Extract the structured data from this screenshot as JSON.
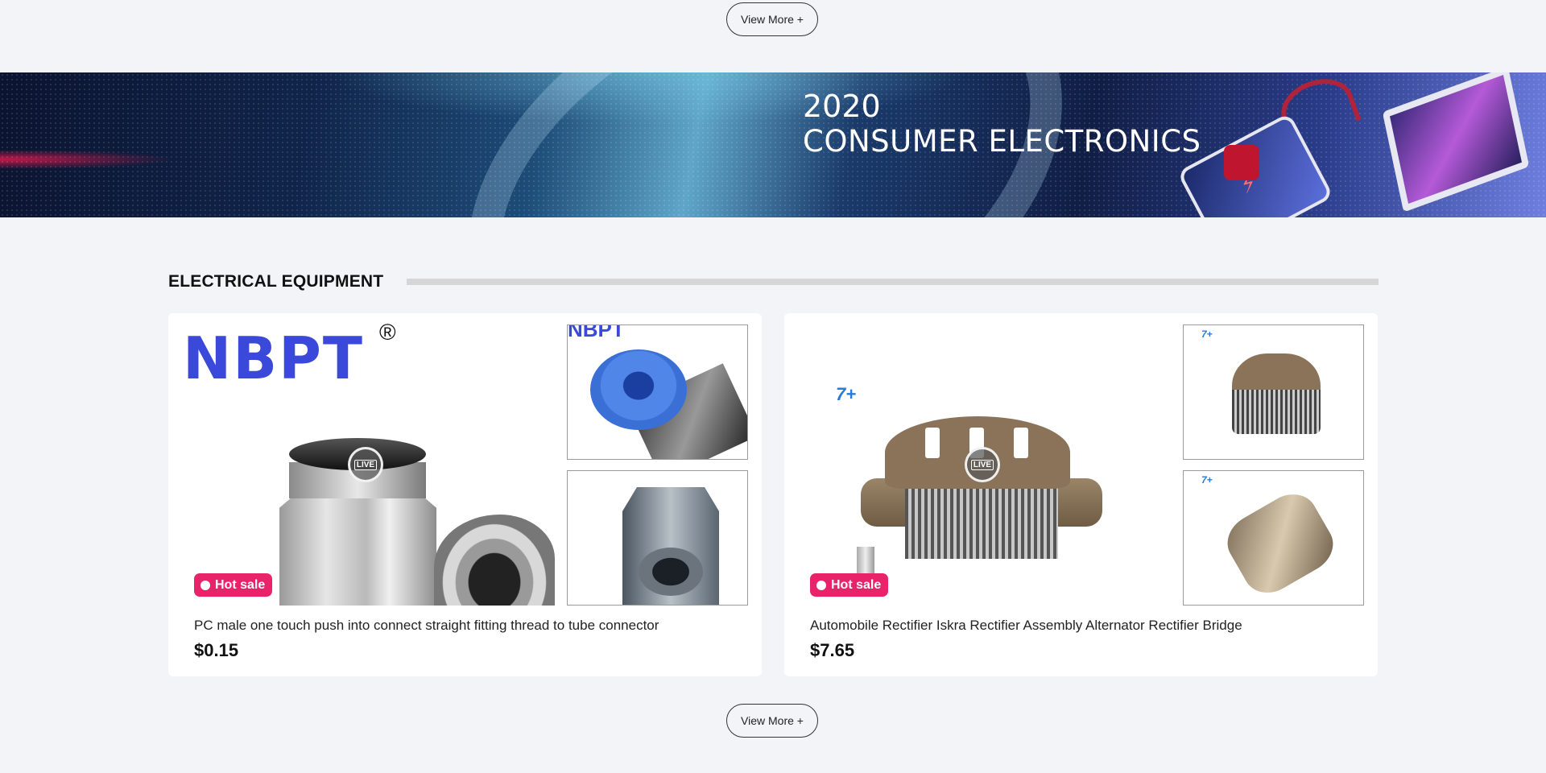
{
  "top_button": {
    "label": "View More +"
  },
  "banner": {
    "year": "2020",
    "title": "CONSUMER ELECTRONICS"
  },
  "section": {
    "title": "ELECTRICAL EQUIPMENT"
  },
  "products": [
    {
      "brand_logo": "NBPT",
      "brand_mark": "®",
      "badge": "Hot sale",
      "live": "LIVE",
      "name": "PC male one touch push into connect straight fitting thread to tube connector",
      "price": "$0.15"
    },
    {
      "brand_logo": "7+",
      "badge": "Hot sale",
      "live": "LIVE",
      "name": "Automobile Rectifier Iskra Rectifier Assembly Alternator Rectifier Bridge",
      "price": "$7.65"
    }
  ],
  "bottom_button": {
    "label": "View More +"
  },
  "colors": {
    "badge": "#e8236a",
    "brand_blue": "#3a49d9",
    "page_bg": "#f3f4f8"
  }
}
